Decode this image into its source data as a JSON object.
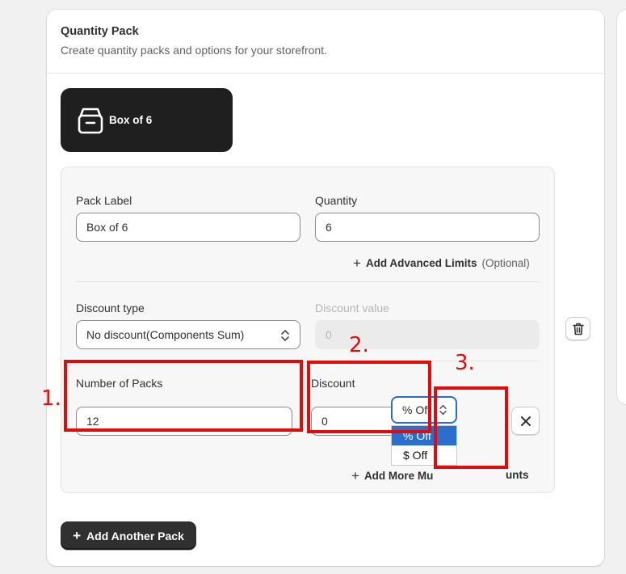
{
  "card": {
    "title": "Quantity Pack",
    "subtitle": "Create quantity packs and options for your storefront."
  },
  "pack_tab": {
    "label": "Box of 6",
    "icon": "box-icon"
  },
  "pack_form": {
    "pack_label_label": "Pack Label",
    "pack_label_value": "Box of 6",
    "quantity_label": "Quantity",
    "quantity_value": "6",
    "add_advanced_limits": "Add Advanced Limits",
    "optional": "(Optional)",
    "discount_type_label": "Discount type",
    "discount_type_value": "No discount(Components Sum)",
    "discount_value_label": "Discount value",
    "discount_value_placeholder": "0",
    "number_of_packs_label": "Number of Packs",
    "number_of_packs_value": "12",
    "discount_label": "Discount",
    "discount_value": "0",
    "discount_unit_selected": "% Off",
    "discount_unit_options": [
      "% Off",
      "$ Off"
    ],
    "add_more_label": "Add More Mu",
    "add_more_tail": "unts"
  },
  "add_another_pack": "Add Another Pack",
  "annotations": [
    "1.",
    "2.",
    "3."
  ],
  "colors": {
    "accent": "#2c6ecb",
    "annotation": "#e20b0b",
    "dark_button": "#303030"
  }
}
